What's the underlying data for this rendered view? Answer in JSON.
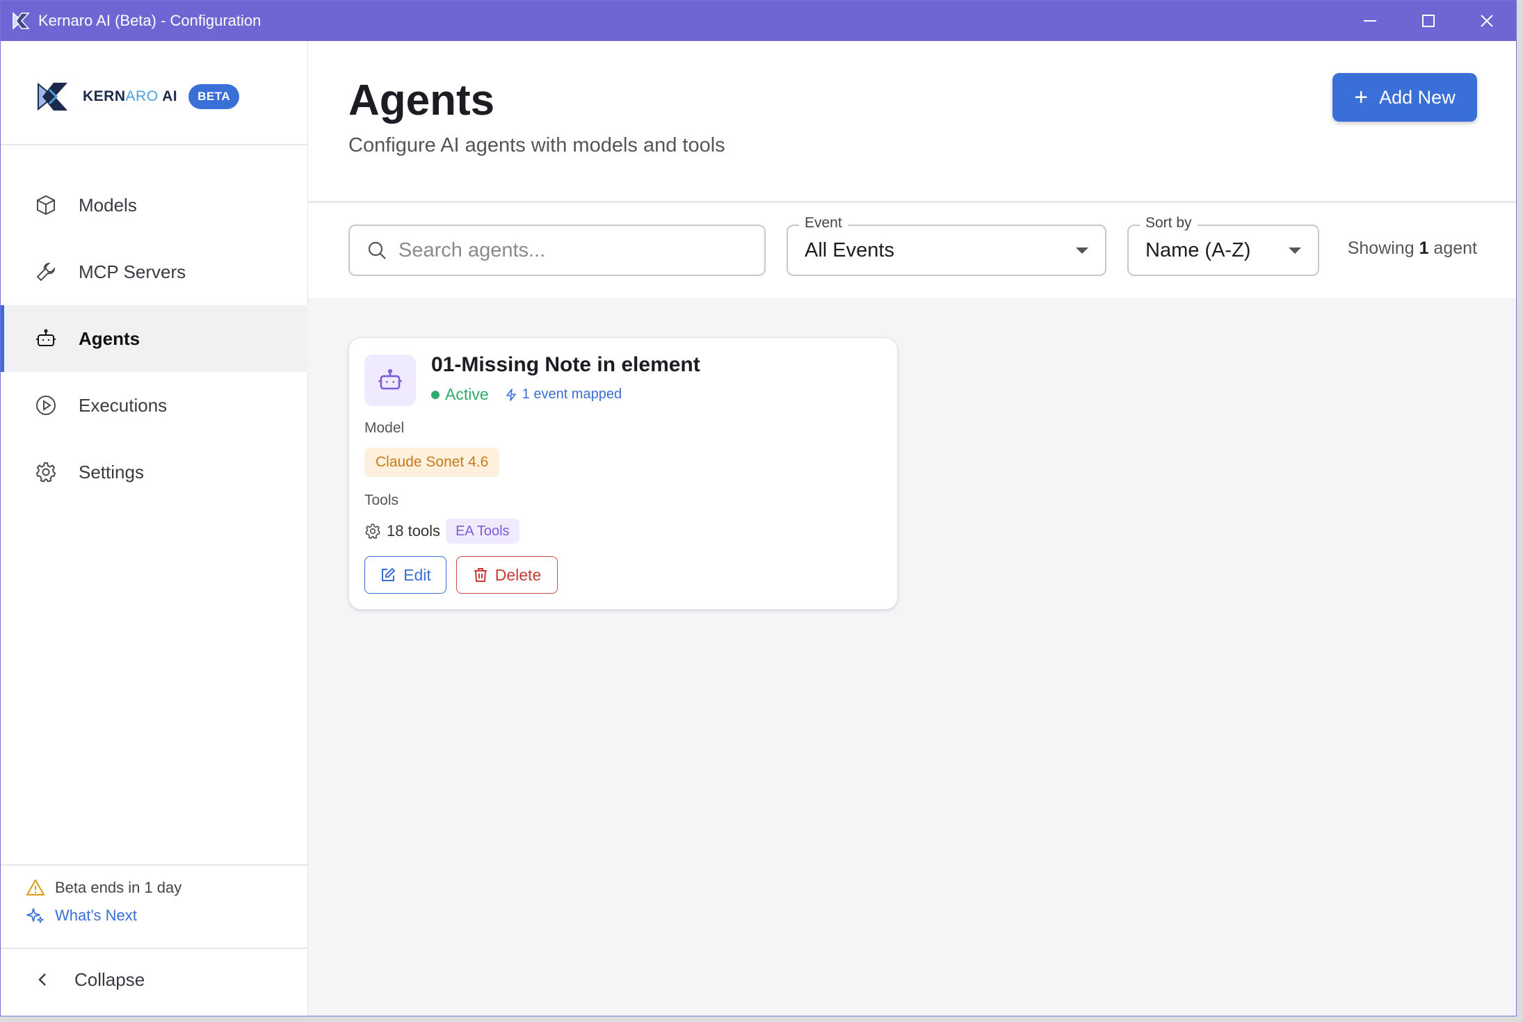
{
  "window": {
    "title": "Kernaro AI (Beta) - Configuration",
    "controls": {
      "minimize_icon": "minimize-icon",
      "maximize_icon": "maximize-icon",
      "close_icon": "close-icon"
    }
  },
  "sidebar": {
    "logo_text_prefix": "KERN",
    "logo_text_mid": "ARO",
    "logo_text_suffix": " AI",
    "beta_badge": "BETA",
    "items": [
      {
        "label": "Models",
        "icon": "cube-icon"
      },
      {
        "label": "MCP Servers",
        "icon": "wrench-icon"
      },
      {
        "label": "Agents",
        "icon": "robot-icon",
        "active": true
      },
      {
        "label": "Executions",
        "icon": "play-circle-icon"
      },
      {
        "label": "Settings",
        "icon": "gear-icon"
      }
    ],
    "beta_notice": "Beta ends in 1 day",
    "whats_next": "What's Next",
    "collapse": "Collapse"
  },
  "header": {
    "title": "Agents",
    "subtitle": "Configure AI agents with models and tools",
    "add_button": "Add New"
  },
  "filters": {
    "search_placeholder": "Search agents...",
    "event_label": "Event",
    "event_value": "All Events",
    "sort_label": "Sort by",
    "sort_value": "Name (A-Z)",
    "showing_prefix": "Showing ",
    "showing_count": "1",
    "showing_suffix": " agent"
  },
  "agents": [
    {
      "name": "01-Missing Note in element",
      "status": "Active",
      "events_mapped": "1 event mapped",
      "model_label": "Model",
      "model": "Claude Sonet 4.6",
      "tools_label": "Tools",
      "tools_count": "18 tools",
      "tools_group": "EA Tools",
      "edit_label": "Edit",
      "delete_label": "Delete"
    }
  ],
  "colors": {
    "titlebar": "#6e67d3",
    "accent": "#3b6fd8",
    "active_status": "#2eaa6a",
    "model_chip_bg": "#fdf0dd",
    "model_chip_text": "#c77a1a",
    "tools_chip_bg": "#efeafd",
    "tools_chip_text": "#7c5ad9",
    "delete": "#c93a35"
  }
}
